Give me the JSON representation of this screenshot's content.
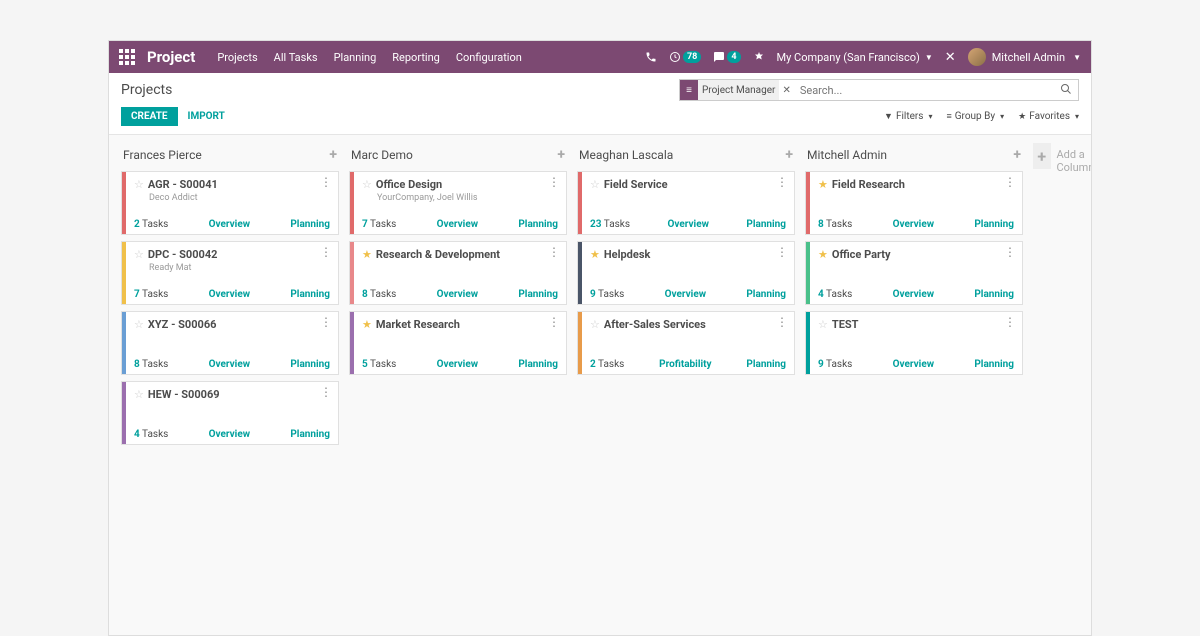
{
  "nav": {
    "brand": "Project",
    "menu": [
      "Projects",
      "All Tasks",
      "Planning",
      "Reporting",
      "Configuration"
    ],
    "clock_badge": "78",
    "chat_badge": "4",
    "company": "My Company (San Francisco)",
    "user": "Mitchell Admin"
  },
  "cp": {
    "breadcrumb": "Projects",
    "filter_facet": "Project Manager",
    "search_placeholder": "Search...",
    "create": "CREATE",
    "import": "IMPORT",
    "filters": "Filters",
    "groupby": "Group By",
    "favorites": "Favorites"
  },
  "add_col": "Add a Column",
  "labels": {
    "tasks": "Tasks",
    "overview": "Overview",
    "planning": "Planning",
    "profitability": "Profitability"
  },
  "cols": [
    {
      "title": "Frances Pierce",
      "cards": [
        {
          "title": "AGR - S00041",
          "sub": "Deco Addict",
          "star": false,
          "stripe": "c-red",
          "count": "2",
          "link2": "overview",
          "link3": "planning"
        },
        {
          "title": "DPC - S00042",
          "sub": "Ready Mat",
          "star": false,
          "stripe": "c-yellow",
          "count": "7",
          "link2": "overview",
          "link3": "planning"
        },
        {
          "title": "XYZ - S00066",
          "sub": "",
          "star": false,
          "stripe": "c-lblue",
          "count": "8",
          "link2": "overview",
          "link3": "planning"
        },
        {
          "title": "HEW - S00069",
          "sub": "",
          "star": false,
          "stripe": "c-purple",
          "count": "4",
          "link2": "overview",
          "link3": "planning"
        }
      ]
    },
    {
      "title": "Marc Demo",
      "cards": [
        {
          "title": "Office Design",
          "sub": "YourCompany, Joel Willis",
          "star": false,
          "stripe": "c-red",
          "count": "7",
          "link2": "overview",
          "link3": "planning"
        },
        {
          "title": "Research & Development",
          "sub": "",
          "star": true,
          "stripe": "c-lred",
          "count": "8",
          "link2": "overview",
          "link3": "planning"
        },
        {
          "title": "Market Research",
          "sub": "",
          "star": true,
          "stripe": "c-purple",
          "count": "5",
          "link2": "overview",
          "link3": "planning"
        }
      ]
    },
    {
      "title": "Meaghan Lascala",
      "cards": [
        {
          "title": "Field Service",
          "sub": "",
          "star": false,
          "stripe": "c-red",
          "count": "23",
          "link2": "overview",
          "link3": "planning"
        },
        {
          "title": "Helpdesk",
          "sub": "",
          "star": true,
          "stripe": "c-dgrey",
          "count": "9",
          "link2": "overview",
          "link3": "planning"
        },
        {
          "title": "After-Sales Services",
          "sub": "",
          "star": false,
          "stripe": "c-orange",
          "count": "2",
          "link2": "profitability",
          "link3": "planning"
        }
      ]
    },
    {
      "title": "Mitchell Admin",
      "cards": [
        {
          "title": "Field Research",
          "sub": "",
          "star": true,
          "stripe": "c-red",
          "count": "8",
          "link2": "overview",
          "link3": "planning"
        },
        {
          "title": "Office Party",
          "sub": "",
          "star": true,
          "stripe": "c-green",
          "count": "4",
          "link2": "overview",
          "link3": "planning"
        },
        {
          "title": "TEST",
          "sub": "",
          "star": false,
          "stripe": "c-teal",
          "count": "9",
          "link2": "overview",
          "link3": "planning"
        }
      ]
    }
  ]
}
